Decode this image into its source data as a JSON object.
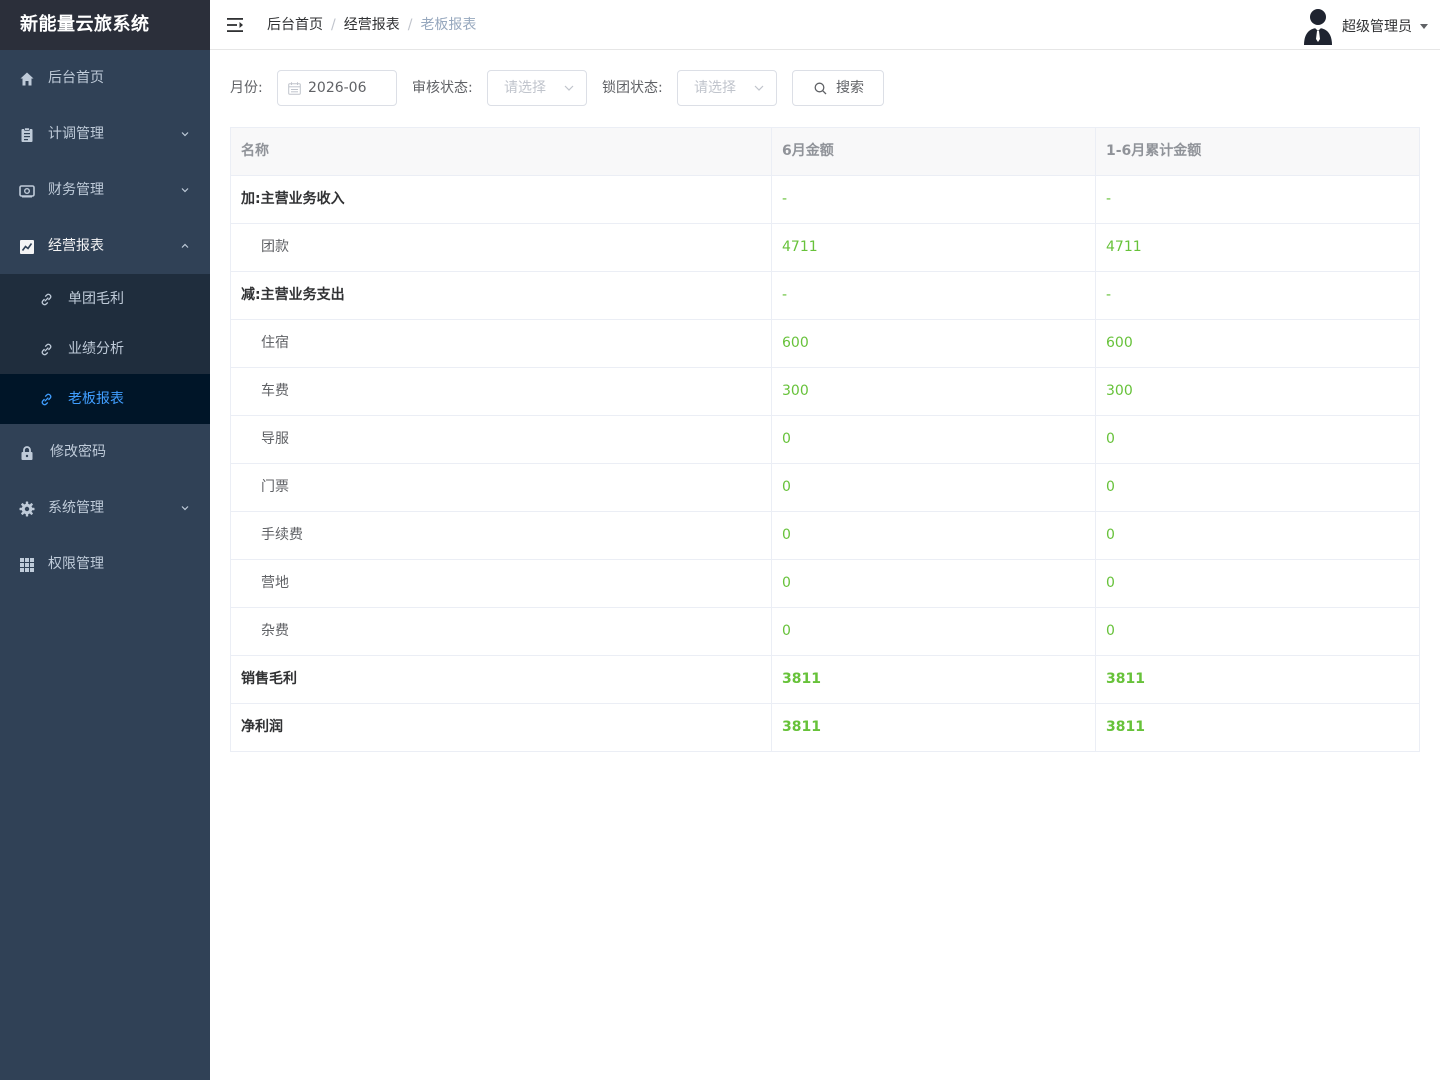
{
  "app": {
    "title": "新能量云旅系统"
  },
  "sidebar": {
    "items": [
      {
        "label": "后台首页",
        "icon": "home-icon"
      },
      {
        "label": "计调管理",
        "icon": "clipboard-icon"
      },
      {
        "label": "财务管理",
        "icon": "wallet-icon"
      },
      {
        "label": "经营报表",
        "icon": "chart-icon",
        "expanded": true,
        "children": [
          {
            "label": "单团毛利",
            "icon": "link-icon"
          },
          {
            "label": "业绩分析",
            "icon": "link-icon"
          },
          {
            "label": "老板报表",
            "icon": "link-icon",
            "active": true
          }
        ]
      },
      {
        "label": "修改密码",
        "icon": "lock-icon"
      },
      {
        "label": "系统管理",
        "icon": "gear-icon"
      },
      {
        "label": "权限管理",
        "icon": "grid-icon"
      }
    ]
  },
  "header": {
    "breadcrumb": [
      "后台首页",
      "经营报表",
      "老板报表"
    ],
    "user_name": "超级管理员"
  },
  "filters": {
    "month_label": "月份:",
    "month_value": "2026-06",
    "audit_label": "审核状态:",
    "audit_placeholder": "请选择",
    "lock_label": "锁团状态:",
    "lock_placeholder": "请选择",
    "search_label": "搜索"
  },
  "table": {
    "columns": [
      "名称",
      "6月金额",
      "1-6月累计金额"
    ],
    "rows": [
      {
        "name": "加:主营业务收入",
        "month": "-",
        "ytd": "-"
      },
      {
        "name": "团款",
        "month": "4711",
        "ytd": "4711"
      },
      {
        "name": "减:主营业务支出",
        "month": "-",
        "ytd": "-"
      },
      {
        "name": "住宿",
        "month": "600",
        "ytd": "600"
      },
      {
        "name": "车费",
        "month": "300",
        "ytd": "300"
      },
      {
        "name": "导服",
        "month": "0",
        "ytd": "0"
      },
      {
        "name": "门票",
        "month": "0",
        "ytd": "0"
      },
      {
        "name": "手续费",
        "month": "0",
        "ytd": "0"
      },
      {
        "name": "营地",
        "month": "0",
        "ytd": "0"
      },
      {
        "name": "杂费",
        "month": "0",
        "ytd": "0"
      },
      {
        "name": "销售毛利",
        "month": "3811",
        "ytd": "3811"
      },
      {
        "name": "净利润",
        "month": "3811",
        "ytd": "3811"
      }
    ]
  },
  "colors": {
    "sidebar_bg": "#304156",
    "submenu_bg": "#1f2d3d",
    "active_bg": "#001528",
    "accent": "#409eff",
    "value_green": "#67c23a"
  }
}
